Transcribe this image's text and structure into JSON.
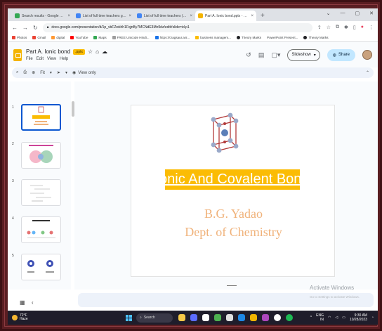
{
  "browser": {
    "tabs": [
      {
        "label": "Search results - Google Drive",
        "color": "#34a853",
        "active": false
      },
      {
        "label": "List of full time teachers google",
        "color": "#4285f4",
        "active": false
      },
      {
        "label": "List of full time teachers (CTU)",
        "color": "#4285f4",
        "active": false
      },
      {
        "label": "Part A. Ionic bond.pptx - Google",
        "color": "#f4b400",
        "active": true
      }
    ],
    "new_tab": "+",
    "window_controls": [
      "⌄",
      "—",
      "▢",
      "✕"
    ],
    "url": "docs.google.com/presentation/d/1p_vbFZwkhh1FqjnBy7MCNdE3Mn9dz/edit#slide=id.p1",
    "bookmarks": [
      {
        "label": "Photos",
        "color": "#ea4335"
      },
      {
        "label": "Gmail",
        "color": "#ea4335"
      },
      {
        "label": "digital",
        "color": "#ff9933"
      },
      {
        "label": "YouTube",
        "color": "#ff0000"
      },
      {
        "label": "Maps",
        "color": "#34a853"
      },
      {
        "label": "FREE Unicode Hindi...",
        "color": "#9e9e9e"
      },
      {
        "label": "https://cragsaur.ani...",
        "color": "#1a73e8"
      },
      {
        "label": "business managem...",
        "color": "#fbbc04"
      },
      {
        "label": "Theory Marks",
        "color": "#202124"
      },
      {
        "label": "PowerPoint Present...",
        "color": "#202124"
      },
      {
        "label": "Theory Marks",
        "color": "#202124"
      }
    ]
  },
  "slides": {
    "doc_title": "Part A. Ionic bond",
    "doc_badge": ".pptx",
    "menus": [
      "File",
      "Edit",
      "View",
      "Help"
    ],
    "slideshow_label": "Slideshow",
    "share_label": "Share",
    "toolbar": {
      "zoom": "Fit",
      "view_only": "View only"
    },
    "thumbnails": [
      {
        "num": "1",
        "selected": true
      },
      {
        "num": "2",
        "selected": false
      },
      {
        "num": "3",
        "selected": false
      },
      {
        "num": "4",
        "selected": false
      },
      {
        "num": "5",
        "selected": false
      }
    ],
    "slide": {
      "title": "Ionic And Covalent Bond",
      "author": "B.G. Yadao",
      "department": "Dept. of Chemistry"
    }
  },
  "watermark": {
    "title": "Activate Windows",
    "subtitle": "Go to Settings to activate Windows."
  },
  "taskbar": {
    "temp": "72°F",
    "condition": "Haze",
    "search": "Search",
    "lang": "ENG",
    "region": "IN",
    "time": "9:30 AM",
    "date": "10/28/2023"
  }
}
